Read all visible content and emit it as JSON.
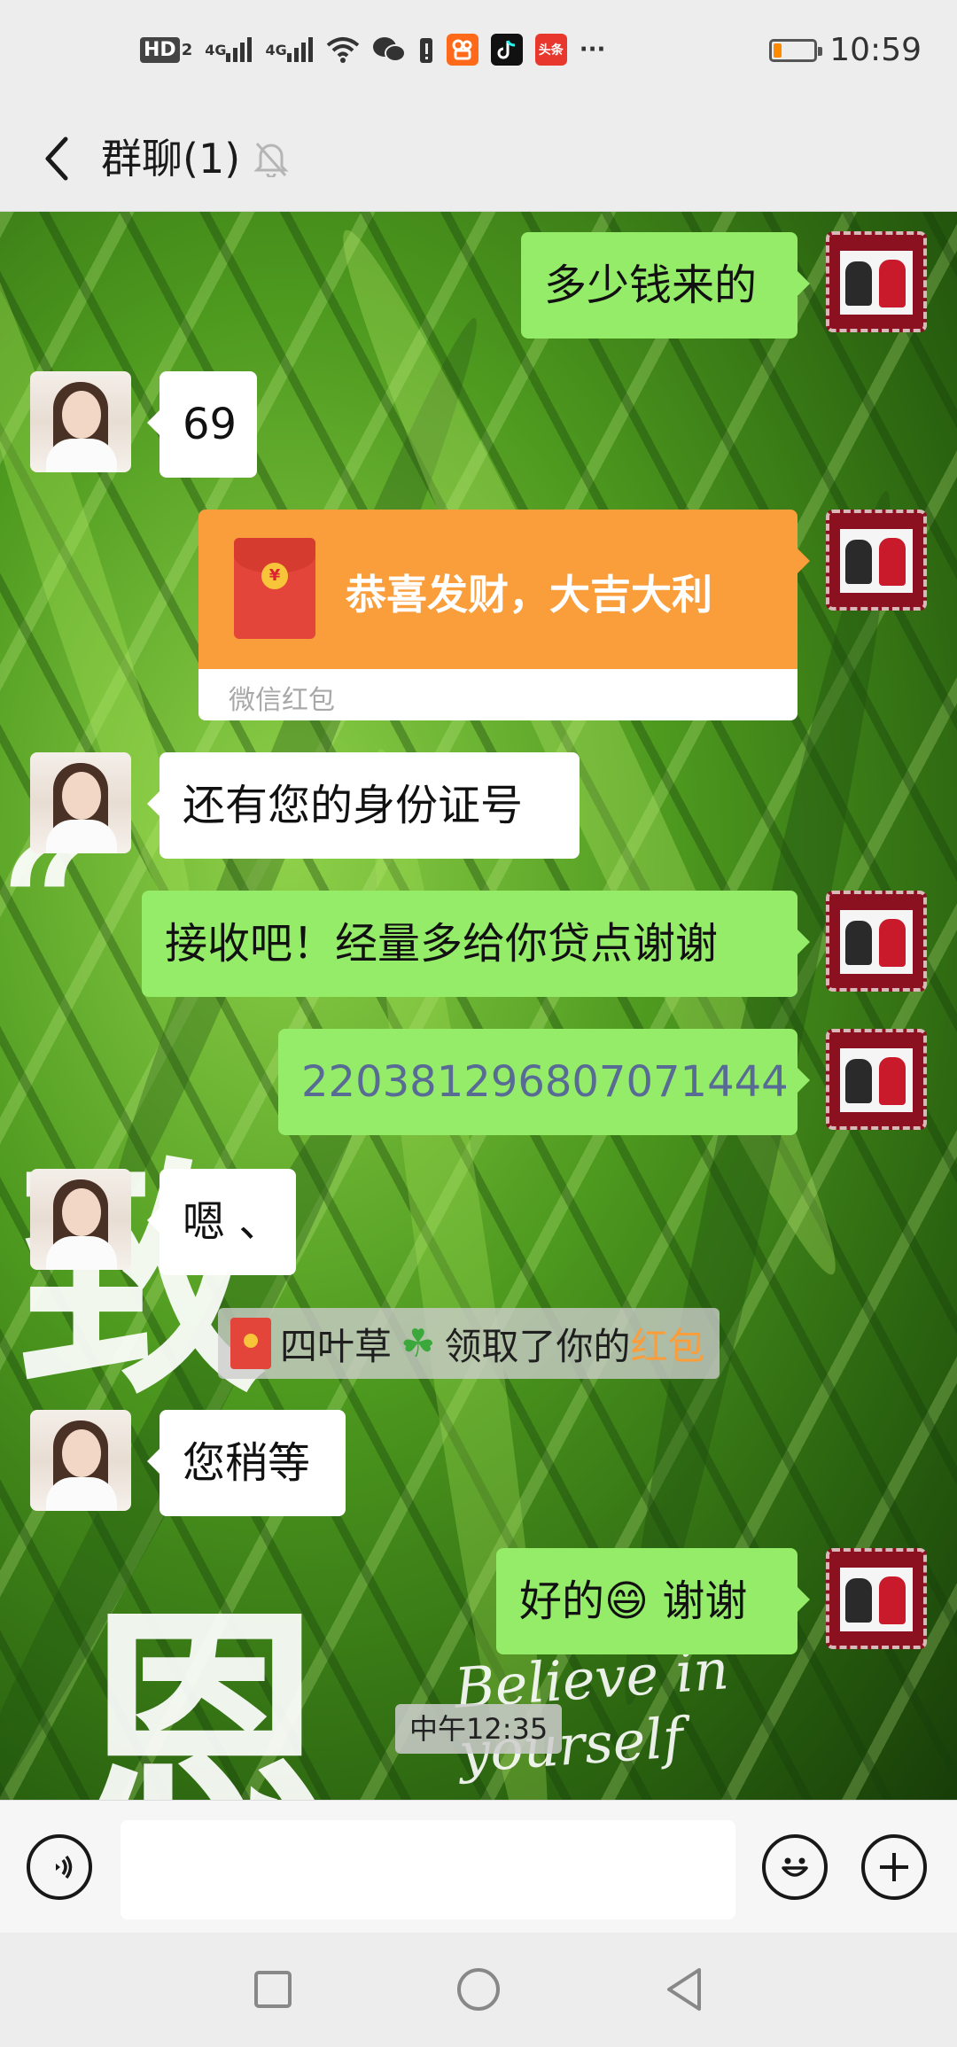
{
  "status_bar": {
    "network_label": "HD",
    "network_sub": "2",
    "signal_1": "4G",
    "signal_2": "4G",
    "more": "···",
    "time": "10:59",
    "battery_level": 0.2,
    "battery_color": "#ff8a00",
    "icons": [
      "signal-icon",
      "wifi-icon",
      "wechat-icon",
      "notification-icon",
      "kuaishou-icon",
      "tiktok-icon",
      "toutiao-icon"
    ],
    "toutiao_label": "头条"
  },
  "header": {
    "title": "群聊(1)",
    "muted_icon": "bell-muted-icon"
  },
  "messages": [
    {
      "side": "out",
      "type": "text",
      "text": "多少钱来的"
    },
    {
      "side": "in",
      "type": "text",
      "text": "69"
    },
    {
      "side": "out",
      "type": "red_packet",
      "text": "恭喜发财，大吉大利",
      "brand": "微信红包"
    },
    {
      "side": "in",
      "type": "text",
      "text": "还有您的身份证号"
    },
    {
      "side": "out",
      "type": "text",
      "text": "接收吧！经量多给你贷点谢谢"
    },
    {
      "side": "out",
      "type": "text",
      "text": "220381296807071444"
    },
    {
      "side": "in",
      "type": "text",
      "text": "嗯 、"
    },
    {
      "side": "system",
      "type": "notice",
      "prefix": "四叶草",
      "middle": "领取了你的",
      "highlight": "红包"
    },
    {
      "side": "in",
      "type": "text",
      "text": "您稍等"
    },
    {
      "side": "out",
      "type": "text",
      "text": "好的",
      "emoji": "😄",
      "suffix": " 谢谢"
    }
  ],
  "timestamp": "中午12:35",
  "wallpaper_text": {
    "char_1": "“",
    "char_2": "致",
    "char_3": "恩",
    "slogan": "Believe in yourself"
  },
  "input_bar": {
    "value": "",
    "placeholder": ""
  },
  "colors": {
    "outgoing_bubble": "#95ec69",
    "incoming_bubble": "#ffffff",
    "red_packet": "#fa9d3b",
    "link_text": "#576b95"
  }
}
